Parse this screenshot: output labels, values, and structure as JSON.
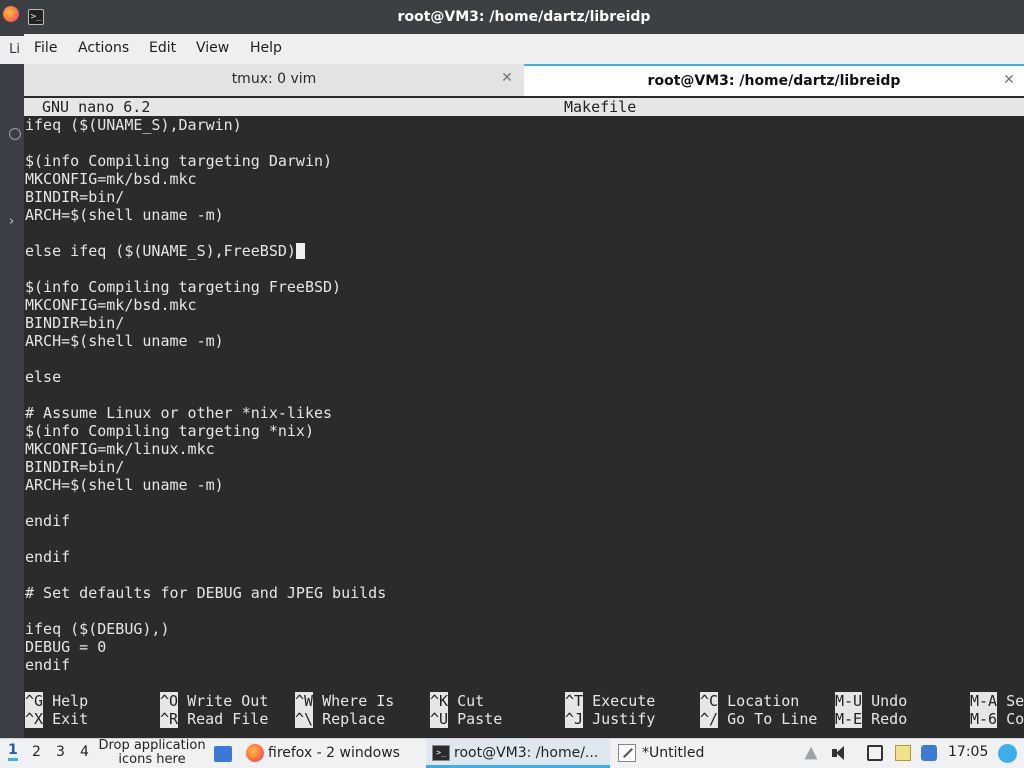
{
  "window": {
    "title": "root@VM3: /home/dartz/libreidp",
    "icon": "terminal-icon"
  },
  "menubar": [
    "File",
    "Actions",
    "Edit",
    "View",
    "Help"
  ],
  "tabs": [
    {
      "label": "tmux: 0 vim",
      "active": false
    },
    {
      "label": "root@VM3: /home/dartz/libreidp",
      "active": true
    }
  ],
  "editor": {
    "version": "GNU nano 6.2",
    "filename": "Makefile",
    "lines": [
      "ifeq ($(UNAME_S),Darwin)",
      "",
      "$(info Compiling targeting Darwin)",
      "MKCONFIG=mk/bsd.mkc",
      "BINDIR=bin/",
      "ARCH=$(shell uname -m)",
      "",
      "else ifeq ($(UNAME_S),FreeBSD)",
      "",
      "$(info Compiling targeting FreeBSD)",
      "MKCONFIG=mk/bsd.mkc",
      "BINDIR=bin/",
      "ARCH=$(shell uname -m)",
      "",
      "else",
      "",
      "# Assume Linux or other *nix-likes",
      "$(info Compiling targeting *nix)",
      "MKCONFIG=mk/linux.mkc",
      "BINDIR=bin/",
      "ARCH=$(shell uname -m)",
      "",
      "endif",
      "",
      "endif",
      "",
      "# Set defaults for DEBUG and JPEG builds",
      "",
      "ifeq ($(DEBUG),)",
      "DEBUG = 0",
      "endif"
    ],
    "shortcuts": [
      {
        "key": "^G",
        "label": "Help"
      },
      {
        "key": "^O",
        "label": "Write Out"
      },
      {
        "key": "^W",
        "label": "Where Is"
      },
      {
        "key": "^K",
        "label": "Cut"
      },
      {
        "key": "^T",
        "label": "Execute"
      },
      {
        "key": "^C",
        "label": "Location"
      },
      {
        "key": "M-U",
        "label": "Undo"
      },
      {
        "key": "M-A",
        "label": "Se"
      },
      {
        "key": "^X",
        "label": "Exit"
      },
      {
        "key": "^R",
        "label": "Read File"
      },
      {
        "key": "^\\",
        "label": "Replace"
      },
      {
        "key": "^U",
        "label": "Paste"
      },
      {
        "key": "^J",
        "label": "Justify"
      },
      {
        "key": "^/",
        "label": "Go To Line"
      },
      {
        "key": "M-E",
        "label": "Redo"
      },
      {
        "key": "M-6",
        "label": "Co"
      }
    ]
  },
  "background_window": {
    "fragment": "Li"
  },
  "taskbar": {
    "workspaces": [
      "1",
      "2",
      "3",
      "4"
    ],
    "active_workspace": "1",
    "drop_hint": "Drop application icons here",
    "tasks": [
      {
        "label": "firefox - 2 windows",
        "icon": "firefox-icon"
      },
      {
        "label": "root@VM3: /home/...",
        "icon": "terminal-icon"
      },
      {
        "label": "*Untitled",
        "icon": "text-editor-icon"
      }
    ],
    "clock": "17:05"
  }
}
